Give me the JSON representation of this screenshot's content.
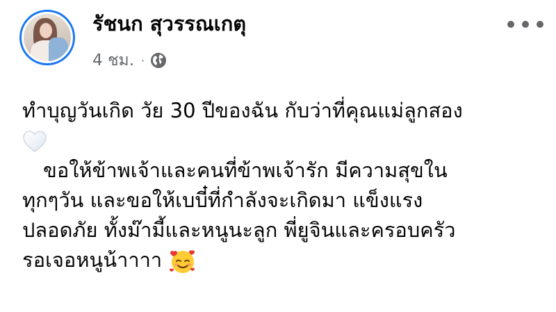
{
  "post": {
    "author": "รัชนก สุวรรณเกตุ",
    "time": "4 ชม.",
    "separator": "·",
    "privacy_icon": "globe-icon",
    "more_icon": "more-options-icon",
    "body_lines": [
      "ทำบุญวันเกิด วัย 30 ปีของฉัน กับว่าที่คุณแม่ลูกสอง",
      "ขอให้ข้าพเจ้าและคนที่ข้าพเจ้ารัก มีความสุขใน",
      "ทุกๆวัน และขอให้เบบี๋ที่กำลังจะเกิดมา แข็งแรง",
      "ปลอดภัย ทั้งม๊ามี้และหนูนะลูก พี่ยูจินและครอบครัว",
      "รอเจอหนูน้าาาา"
    ],
    "emojis": [
      "white-heart-icon",
      "smiling-face-with-hearts-icon"
    ]
  },
  "colors": {
    "accent": "#1877f2",
    "text": "#050505",
    "secondary": "#65676b",
    "background": "#ffffff"
  }
}
